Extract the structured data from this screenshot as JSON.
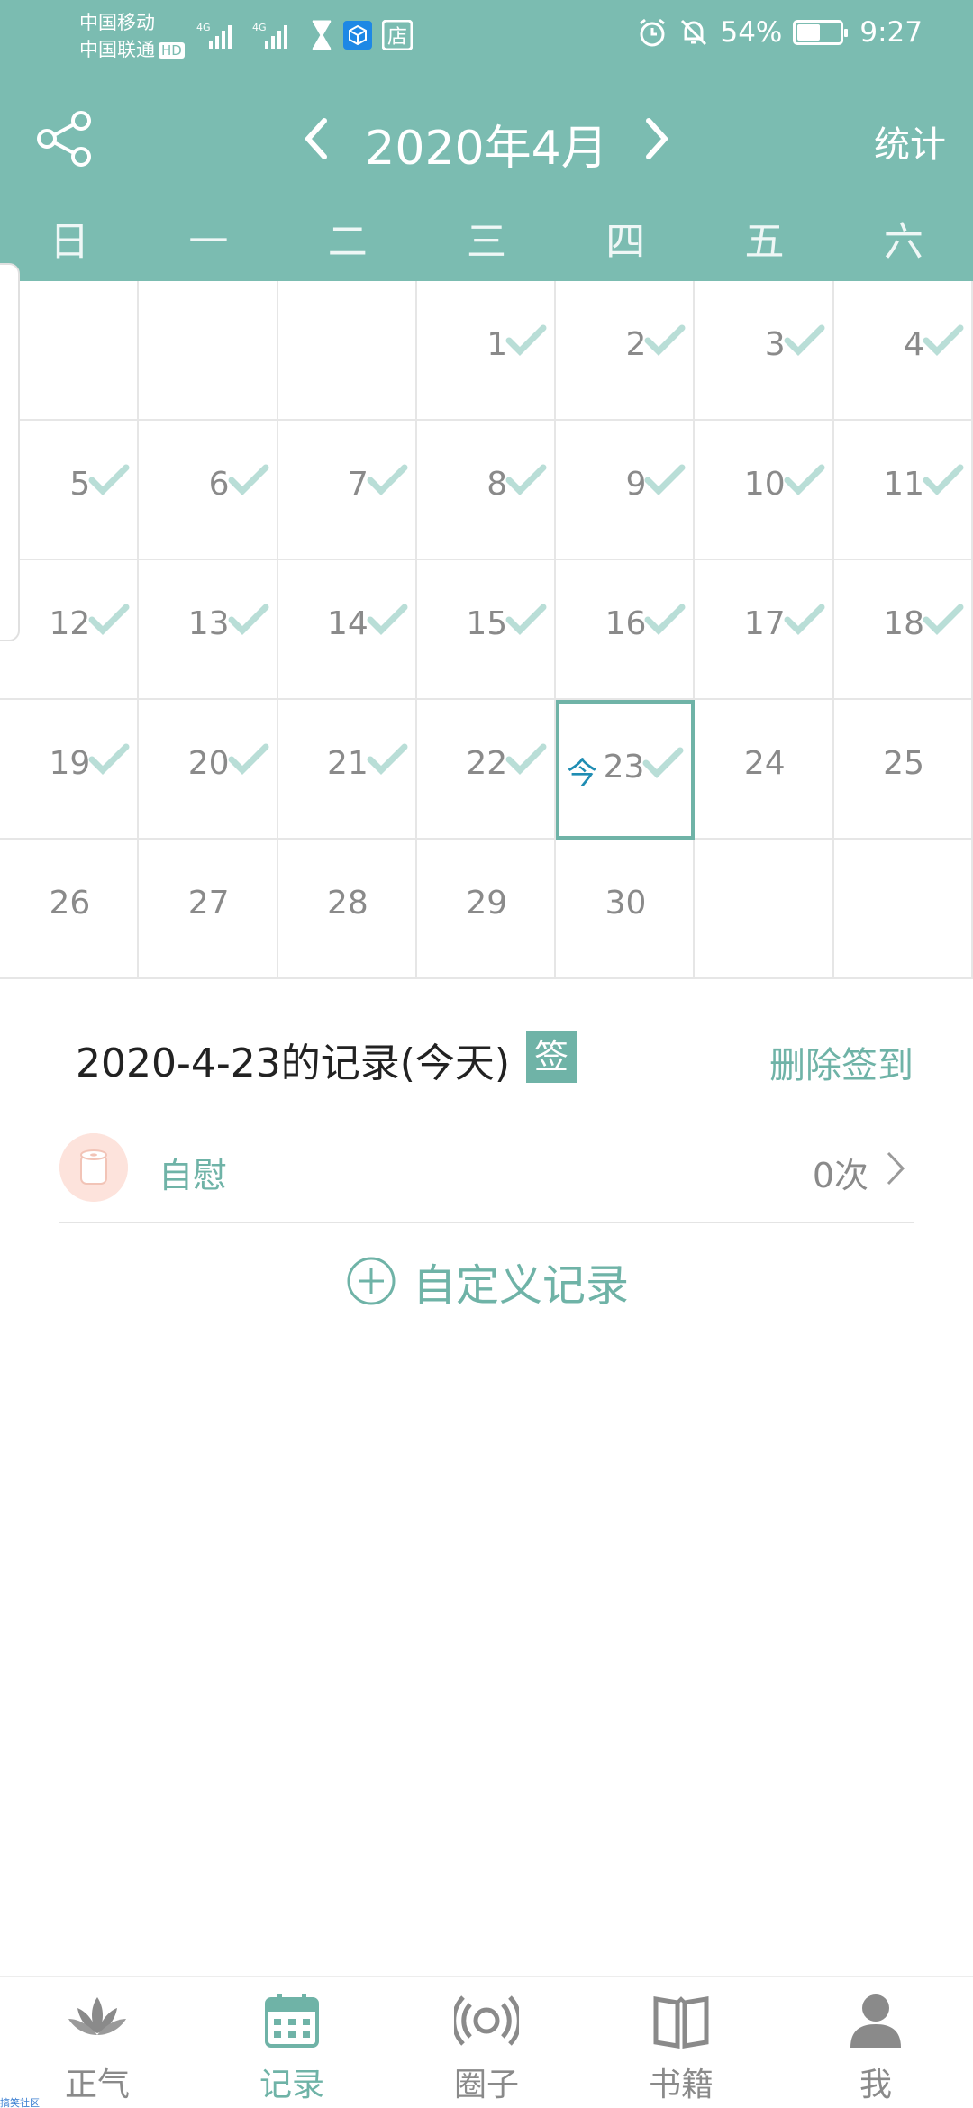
{
  "status_bar": {
    "carrier_1": "中国移动",
    "carrier_2": "中国联通",
    "hd_badge": "HD",
    "network_1": "4G",
    "network_2": "4G",
    "store_icon_text": "店",
    "battery_percent": "54%",
    "battery_level": 0.54,
    "time": "9:27"
  },
  "header": {
    "month_title": "2020年4月",
    "stats_label": "统计",
    "weekdays": [
      "日",
      "一",
      "二",
      "三",
      "四",
      "五",
      "六"
    ]
  },
  "calendar": {
    "today_mark": "今",
    "days": [
      {
        "label": "1",
        "signed": true
      },
      {
        "label": "2",
        "signed": true
      },
      {
        "label": "3",
        "signed": true
      },
      {
        "label": "4",
        "signed": true
      },
      {
        "label": "5",
        "signed": true
      },
      {
        "label": "6",
        "signed": true
      },
      {
        "label": "7",
        "signed": true
      },
      {
        "label": "8",
        "signed": true
      },
      {
        "label": "9",
        "signed": true
      },
      {
        "label": "10",
        "signed": true
      },
      {
        "label": "11",
        "signed": true
      },
      {
        "label": "12",
        "signed": true
      },
      {
        "label": "13",
        "signed": true
      },
      {
        "label": "14",
        "signed": true
      },
      {
        "label": "15",
        "signed": true
      },
      {
        "label": "16",
        "signed": true
      },
      {
        "label": "17",
        "signed": true
      },
      {
        "label": "18",
        "signed": true
      },
      {
        "label": "19",
        "signed": true
      },
      {
        "label": "20",
        "signed": true
      },
      {
        "label": "21",
        "signed": true
      },
      {
        "label": "22",
        "signed": true
      },
      {
        "label": "23",
        "signed": true,
        "today": true
      },
      {
        "label": "24",
        "signed": false
      },
      {
        "label": "25",
        "signed": false
      },
      {
        "label": "26",
        "signed": false
      },
      {
        "label": "27",
        "signed": false
      },
      {
        "label": "28",
        "signed": false
      },
      {
        "label": "29",
        "signed": false
      },
      {
        "label": "30",
        "signed": false
      }
    ]
  },
  "record": {
    "title": "2020-4-23的记录(今天)",
    "sign_badge": "签",
    "delete_label": "删除签到",
    "item_label": "自慰",
    "item_count": "0次",
    "custom_label": "自定义记录"
  },
  "nav": [
    {
      "label": "正气",
      "icon": "lotus-icon",
      "active": false
    },
    {
      "label": "记录",
      "icon": "calendar-icon",
      "active": true
    },
    {
      "label": "圈子",
      "icon": "broadcast-icon",
      "active": false
    },
    {
      "label": "书籍",
      "icon": "book-icon",
      "active": false
    },
    {
      "label": "我",
      "icon": "person-icon",
      "active": false
    }
  ],
  "watermark": "搞笑社区",
  "colors": {
    "header": "#7bbcb1",
    "accent": "#6fb3a7",
    "check": "#b9ded7",
    "today_mark": "#1f8db3"
  }
}
